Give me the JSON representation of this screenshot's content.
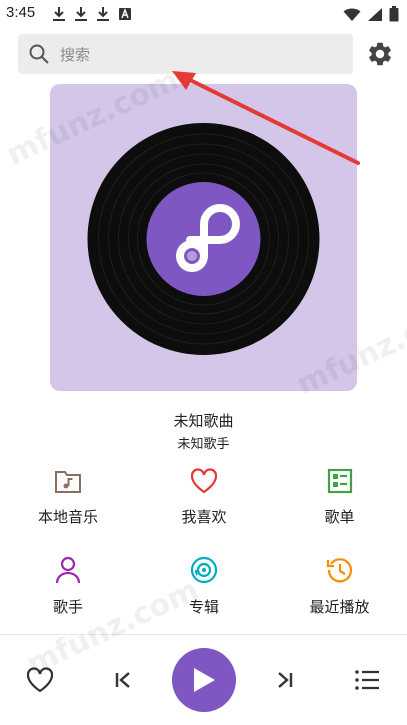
{
  "status_bar": {
    "time": "3:45",
    "left_icons": [
      "download-icon",
      "download-icon",
      "download-icon",
      "a-icon"
    ],
    "right_icons": [
      "wifi-icon",
      "signal-icon",
      "battery-icon"
    ]
  },
  "search": {
    "placeholder": "搜索",
    "value": ""
  },
  "header": {
    "settings_icon": "gear-icon"
  },
  "now_playing": {
    "title": "未知歌曲",
    "artist": "未知歌手",
    "cover_background": "#d3c6e8",
    "disc_label_color": "#7e57c2"
  },
  "shortcuts": [
    {
      "label": "本地音乐",
      "icon": "folder-music-icon",
      "color": "#8d6e63"
    },
    {
      "label": "我喜欢",
      "icon": "heart-icon",
      "color": "#e53935"
    },
    {
      "label": "歌单",
      "icon": "playlist-icon",
      "color": "#43a047"
    },
    {
      "label": "歌手",
      "icon": "person-icon",
      "color": "#9c27b0"
    },
    {
      "label": "专辑",
      "icon": "album-icon",
      "color": "#00acc1"
    },
    {
      "label": "最近播放",
      "icon": "history-icon",
      "color": "#fb8c00"
    }
  ],
  "player_controls": {
    "favorite_icon": "heart-outline-icon",
    "previous_icon": "skip-previous-icon",
    "play_icon": "play-icon",
    "next_icon": "skip-next-icon",
    "queue_icon": "queue-list-icon",
    "accent_color": "#7e57c2"
  },
  "watermark": "mfunz.com",
  "annotation_arrow_color": "#e53935"
}
